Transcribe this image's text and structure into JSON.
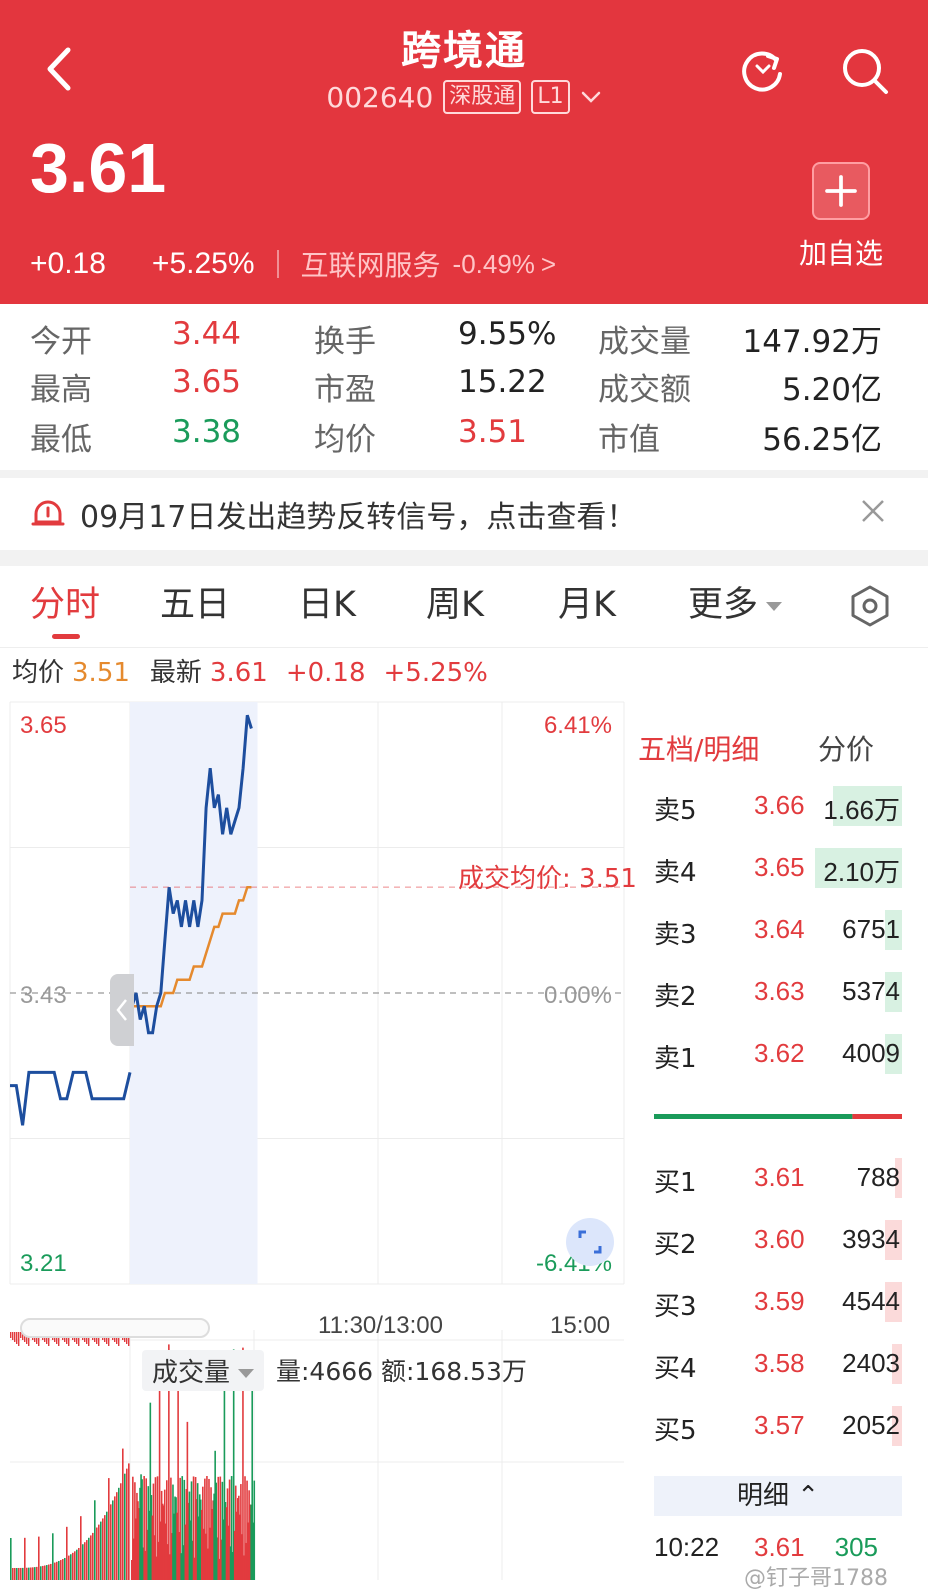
{
  "header": {
    "stock_name": "跨境通",
    "code": "002640",
    "market_tag": "深股通",
    "level_tag": "L1",
    "price": "3.61",
    "change": "+0.18",
    "change_pct": "+5.25%",
    "sector": "互联网服务",
    "sector_pct": "-0.49%",
    "sector_arrow": ">",
    "add_label": "加自选",
    "bg_color": "#e3363e"
  },
  "stats": {
    "rows": [
      [
        {
          "label": "今开",
          "value": "3.44"
        },
        {
          "label": "换手",
          "value": "9.55%"
        },
        {
          "label": "成交量",
          "value": "147.92万"
        }
      ],
      [
        {
          "label": "最高",
          "value": "3.65"
        },
        {
          "label": "市盈",
          "value": "15.22"
        },
        {
          "label": "成交额",
          "value": "5.20亿"
        }
      ],
      [
        {
          "label": "最低",
          "value": "3.38"
        },
        {
          "label": "均价",
          "value": "3.51"
        },
        {
          "label": "市值",
          "value": "56.25亿"
        }
      ]
    ]
  },
  "banner": {
    "text": "09月17日发出趋势反转信号，点击查看！"
  },
  "tabs": [
    "分时",
    "五日",
    "日K",
    "周K",
    "月K",
    "更多"
  ],
  "info_line": {
    "avg_label": "均价",
    "avg_value": "3.51",
    "latest_label": "最新",
    "latest_value": "3.61",
    "change": "+0.18",
    "change_pct": "+5.25%"
  },
  "chart": {
    "y_top": "3.65",
    "y_mid": "3.43",
    "y_bottom": "3.21",
    "pct_top": "6.41%",
    "pct_mid": "0.00%",
    "pct_bottom": "-6.41%",
    "avg_line_label": "成交均价: 3.51",
    "time_mid": "11:30/13:00",
    "time_end": "15:00",
    "volume_label": "成交量",
    "volume_info": "量:4666 额:168.53万",
    "price_color": "#1d4e9e",
    "avg_color": "#e58a2e"
  },
  "chart_data": {
    "type": "line",
    "prev_close": 3.43,
    "ylim": [
      3.21,
      3.65
    ],
    "pre_market": [
      3.36,
      3.36,
      3.33,
      3.37,
      3.37,
      3.37,
      3.37,
      3.37,
      3.35,
      3.35,
      3.37,
      3.37,
      3.37,
      3.35,
      3.35,
      3.35,
      3.35,
      3.35,
      3.35,
      3.37
    ],
    "series": [
      {
        "values": [
          3.42,
          3.43,
          3.41,
          3.42,
          3.4,
          3.4,
          3.42,
          3.43,
          3.47,
          3.51,
          3.49,
          3.5,
          3.48,
          3.5,
          3.48,
          3.5,
          3.48,
          3.5,
          3.57,
          3.6,
          3.57,
          3.58,
          3.55,
          3.57,
          3.55,
          3.56,
          3.57,
          3.6,
          3.64,
          3.63
        ]
      },
      {
        "values": [
          3.42,
          3.42,
          3.42,
          3.42,
          3.42,
          3.42,
          3.42,
          3.42,
          3.43,
          3.43,
          3.43,
          3.44,
          3.44,
          3.44,
          3.44,
          3.45,
          3.45,
          3.45,
          3.46,
          3.47,
          3.48,
          3.48,
          3.49,
          3.49,
          3.49,
          3.49,
          3.5,
          3.5,
          3.51,
          3.51
        ]
      }
    ]
  },
  "order_book": {
    "tab_main": "五档/明细",
    "tab_alt": "分价",
    "sell": [
      {
        "name": "卖5",
        "price": "3.66",
        "qty": "1.66万",
        "level": 0.28
      },
      {
        "name": "卖4",
        "price": "3.65",
        "qty": "2.10万",
        "level": 0.35
      },
      {
        "name": "卖3",
        "price": "3.64",
        "qty": "6751",
        "level": 0.07
      },
      {
        "name": "卖2",
        "price": "3.63",
        "qty": "5374",
        "level": 0.07
      },
      {
        "name": "卖1",
        "price": "3.62",
        "qty": "4009",
        "level": 0.07
      }
    ],
    "buy": [
      {
        "name": "买1",
        "price": "3.61",
        "qty": "788",
        "level": 0.03
      },
      {
        "name": "买2",
        "price": "3.60",
        "qty": "3934",
        "level": 0.07
      },
      {
        "name": "买3",
        "price": "3.59",
        "qty": "4544",
        "level": 0.07
      },
      {
        "name": "买4",
        "price": "3.58",
        "qty": "2403",
        "level": 0.04
      },
      {
        "name": "买5",
        "price": "3.57",
        "qty": "2052",
        "level": 0.04
      }
    ],
    "buy_sell_ratio": 0.8,
    "detail_label": "明细",
    "detail_row": {
      "time": "10:22",
      "price": "3.61",
      "qty": "305"
    }
  },
  "watermark": "@钉子哥1788"
}
